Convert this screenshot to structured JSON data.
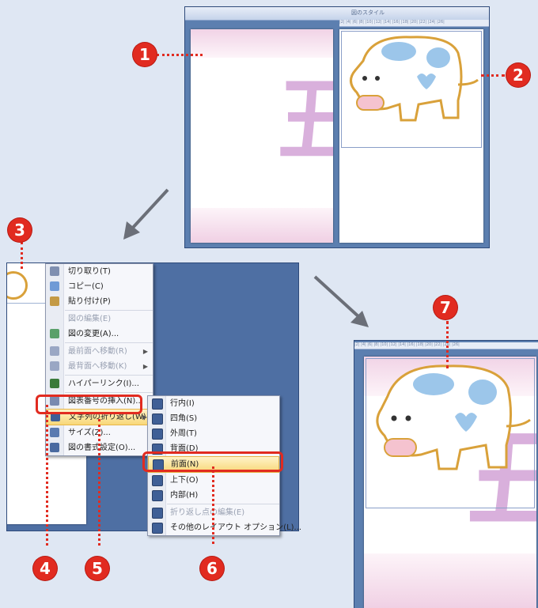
{
  "top_window": {
    "title": "図のスタイル"
  },
  "ruler_text": "|2| |4| |6| |8| |10| |12| |14| |16| |18| |20| |22| |24| |26|",
  "kanji": "丑",
  "badges": [
    "1",
    "2",
    "3",
    "4",
    "5",
    "6",
    "7"
  ],
  "context_menu": [
    {
      "label": "切り取り(T)",
      "icon": "scissors-icon",
      "disabled": false
    },
    {
      "label": "コピー(C)",
      "icon": "copy-icon",
      "disabled": false
    },
    {
      "label": "貼り付け(P)",
      "icon": "paste-icon",
      "disabled": false
    },
    {
      "label": "図の編集(E)",
      "icon": "",
      "disabled": true
    },
    {
      "label": "図の変更(A)...",
      "icon": "change-picture-icon",
      "disabled": false
    },
    {
      "label": "最前面へ移動(R)",
      "icon": "bring-front-icon",
      "disabled": true
    },
    {
      "label": "最背面へ移動(K)",
      "icon": "send-back-icon",
      "disabled": true
    },
    {
      "label": "ハイパーリンク(I)...",
      "icon": "hyperlink-icon",
      "disabled": false
    },
    {
      "label": "図表番号の挿入(N)...",
      "icon": "caption-icon",
      "disabled": false
    },
    {
      "label": "文字列の折り返し(W)",
      "icon": "wrap-icon",
      "disabled": false
    },
    {
      "label": "サイズ(Z)...",
      "icon": "size-icon",
      "disabled": false
    },
    {
      "label": "図の書式設定(O)...",
      "icon": "format-icon",
      "disabled": false
    }
  ],
  "submenu": [
    {
      "label": "行内(I)",
      "disabled": false
    },
    {
      "label": "四角(S)",
      "disabled": false
    },
    {
      "label": "外周(T)",
      "disabled": false
    },
    {
      "label": "背面(D)",
      "disabled": false
    },
    {
      "label": "前面(N)",
      "disabled": false
    },
    {
      "label": "上下(O)",
      "disabled": false
    },
    {
      "label": "内部(H)",
      "disabled": false
    },
    {
      "label": "折り返し点の編集(E)",
      "disabled": true
    },
    {
      "label": "その他のレイアウト オプション(L)...",
      "disabled": false
    }
  ],
  "colors": {
    "callout_red": "#e12b20",
    "window_blue": "#5c7fb0",
    "kanji_pink": "#d9b0dc",
    "cow_blue": "#9cc6ea",
    "cow_outline": "#d9a13a"
  }
}
